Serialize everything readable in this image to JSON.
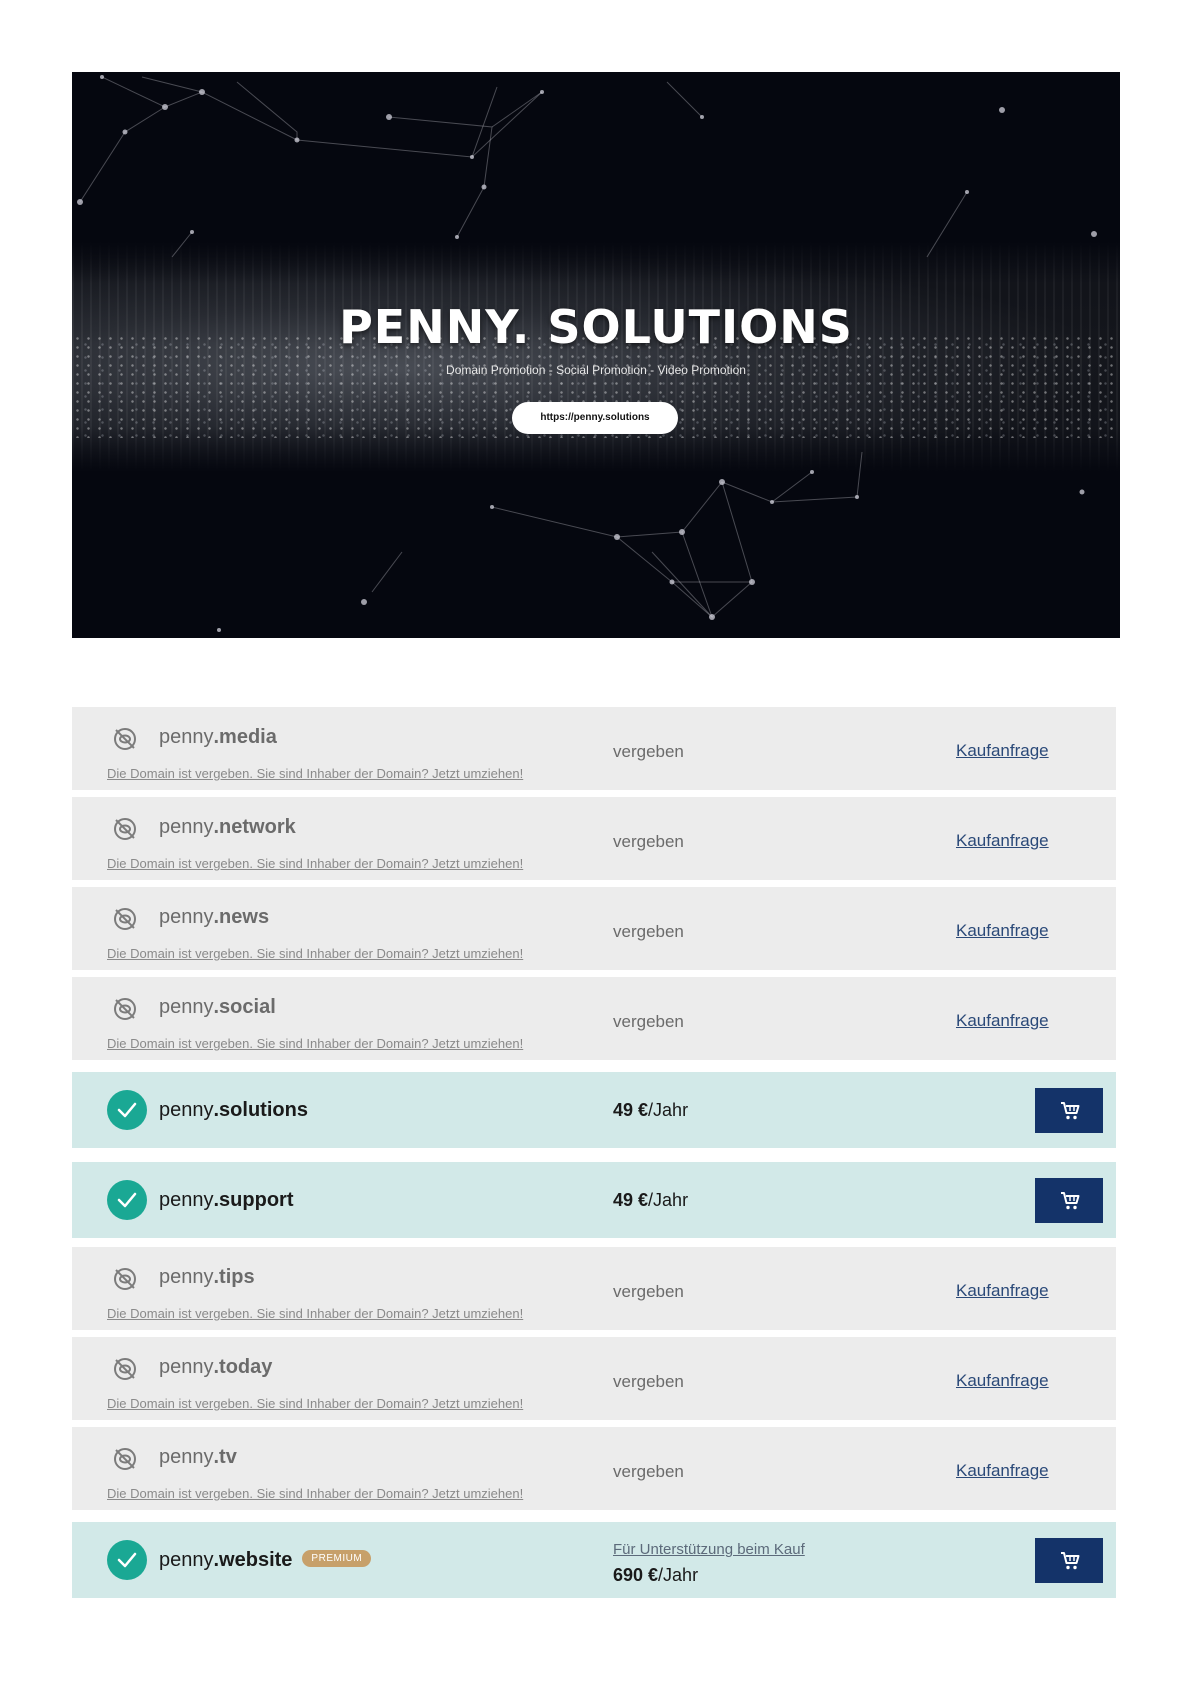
{
  "hero": {
    "title": "PENNY. SOLUTIONS",
    "subtitle": "Domain Promotion - Social Promotion - Video Promotion",
    "url_button": "https://penny.solutions"
  },
  "colors": {
    "taken_row_bg": "#ececec",
    "free_row_bg": "#d2e9e8",
    "check_green": "#1aa894",
    "cart_navy": "#143369",
    "link_blue": "#2b4a79",
    "premium_gold": "#c7a06a"
  },
  "domains": [
    {
      "prefix": "penny",
      "tld": ".media",
      "status": "vergeben",
      "action": "Kaufanfrage",
      "notice": "Die Domain ist vergeben. Sie sind Inhaber der Domain? Jetzt umziehen!",
      "icon": "eye-off-icon"
    },
    {
      "prefix": "penny",
      "tld": ".network",
      "status": "vergeben",
      "action": "Kaufanfrage",
      "notice": "Die Domain ist vergeben. Sie sind Inhaber der Domain? Jetzt umziehen!",
      "icon": "eye-off-icon"
    },
    {
      "prefix": "penny",
      "tld": ".news",
      "status": "vergeben",
      "action": "Kaufanfrage",
      "notice": "Die Domain ist vergeben. Sie sind Inhaber der Domain? Jetzt umziehen!",
      "icon": "eye-off-icon"
    },
    {
      "prefix": "penny",
      "tld": ".social",
      "status": "vergeben",
      "action": "Kaufanfrage",
      "notice": "Die Domain ist vergeben. Sie sind Inhaber der Domain? Jetzt umziehen!",
      "icon": "eye-off-icon"
    },
    {
      "prefix": "penny",
      "tld": ".solutions",
      "price_amount": "49 €",
      "price_unit": "/Jahr",
      "icon": "check-icon",
      "action_icon": "cart-icon"
    },
    {
      "prefix": "penny",
      "tld": ".support",
      "price_amount": "49 €",
      "price_unit": "/Jahr",
      "icon": "check-icon",
      "action_icon": "cart-icon"
    },
    {
      "prefix": "penny",
      "tld": ".tips",
      "status": "vergeben",
      "action": "Kaufanfrage",
      "notice": "Die Domain ist vergeben. Sie sind Inhaber der Domain? Jetzt umziehen!",
      "icon": "eye-off-icon"
    },
    {
      "prefix": "penny",
      "tld": ".today",
      "status": "vergeben",
      "action": "Kaufanfrage",
      "notice": "Die Domain ist vergeben. Sie sind Inhaber der Domain? Jetzt umziehen!",
      "icon": "eye-off-icon"
    },
    {
      "prefix": "penny",
      "tld": ".tv",
      "status": "vergeben",
      "action": "Kaufanfrage",
      "notice": "Die Domain ist vergeben. Sie sind Inhaber der Domain? Jetzt umziehen!",
      "icon": "eye-off-icon"
    },
    {
      "prefix": "penny",
      "tld": ".website",
      "badge": "PREMIUM",
      "support_link": "Für Unterstützung beim Kauf",
      "price_amount": "690 €",
      "price_unit": "/Jahr",
      "icon": "check-icon",
      "action_icon": "cart-icon"
    }
  ]
}
